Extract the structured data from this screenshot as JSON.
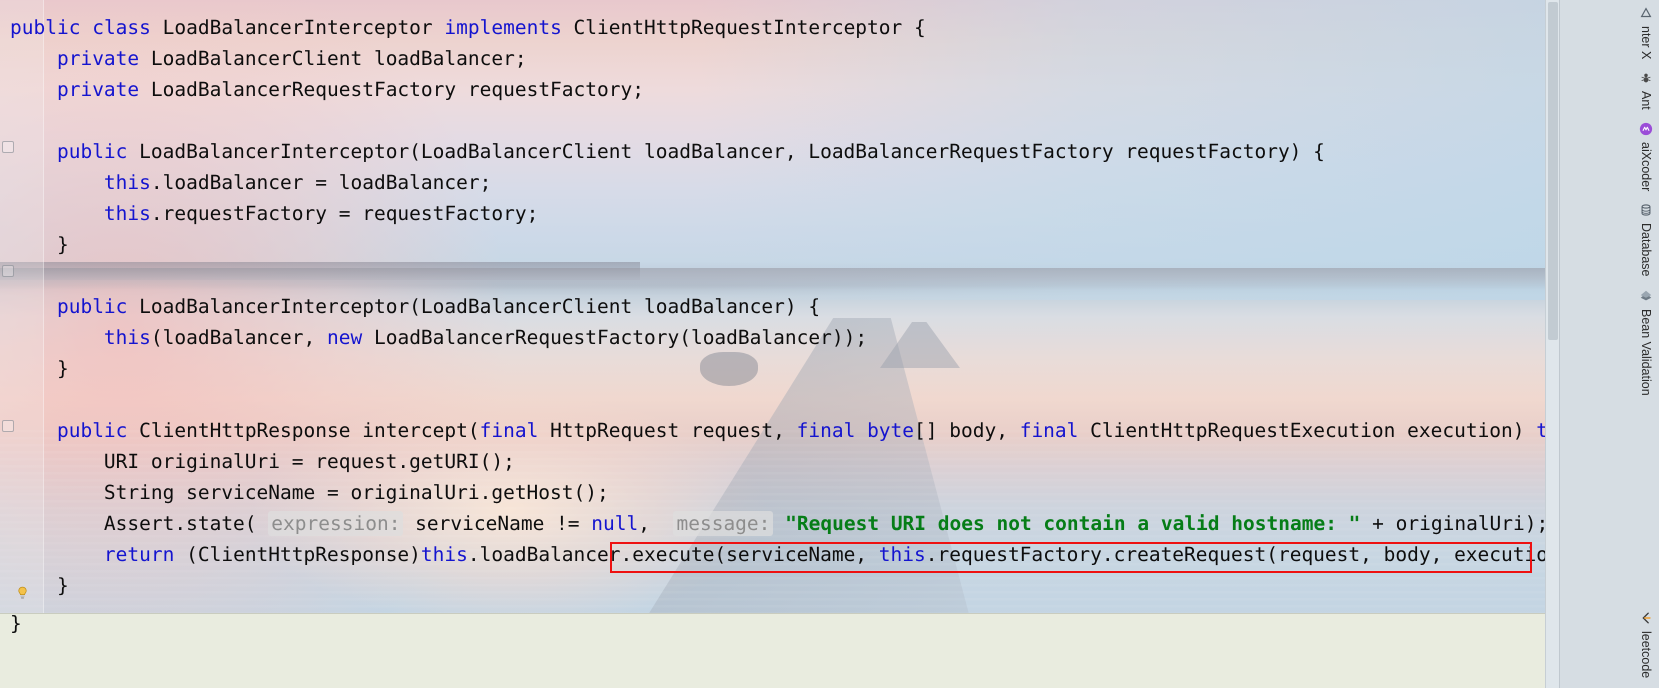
{
  "editor": {
    "language": "java",
    "closing_brace": "}",
    "lines": [
      {
        "indent": 0,
        "tokens": [
          {
            "t": "kw",
            "v": "public"
          },
          {
            "t": "p",
            "v": " "
          },
          {
            "t": "kw",
            "v": "class"
          },
          {
            "t": "p",
            "v": " LoadBalancerInterceptor "
          },
          {
            "t": "kw",
            "v": "implements"
          },
          {
            "t": "p",
            "v": " ClientHttpRequestInterceptor {"
          }
        ]
      },
      {
        "indent": 1,
        "tokens": [
          {
            "t": "kw",
            "v": "private"
          },
          {
            "t": "p",
            "v": " LoadBalancerClient loadBalancer;"
          }
        ]
      },
      {
        "indent": 1,
        "tokens": [
          {
            "t": "kw",
            "v": "private"
          },
          {
            "t": "p",
            "v": " LoadBalancerRequestFactory requestFactory;"
          }
        ]
      },
      {
        "indent": 0,
        "tokens": []
      },
      {
        "indent": 1,
        "tokens": [
          {
            "t": "kw",
            "v": "public"
          },
          {
            "t": "p",
            "v": " LoadBalancerInterceptor(LoadBalancerClient loadBalancer, LoadBalancerRequestFactory requestFactory) {"
          }
        ]
      },
      {
        "indent": 2,
        "tokens": [
          {
            "t": "kw",
            "v": "this"
          },
          {
            "t": "p",
            "v": ".loadBalancer = loadBalancer;"
          }
        ]
      },
      {
        "indent": 2,
        "tokens": [
          {
            "t": "kw",
            "v": "this"
          },
          {
            "t": "p",
            "v": ".requestFactory = requestFactory;"
          }
        ]
      },
      {
        "indent": 1,
        "tokens": [
          {
            "t": "p",
            "v": "}"
          }
        ]
      },
      {
        "indent": 0,
        "tokens": []
      },
      {
        "indent": 1,
        "tokens": [
          {
            "t": "kw",
            "v": "public"
          },
          {
            "t": "p",
            "v": " LoadBalancerInterceptor(LoadBalancerClient loadBalancer) {"
          }
        ]
      },
      {
        "indent": 2,
        "tokens": [
          {
            "t": "kw",
            "v": "this"
          },
          {
            "t": "p",
            "v": "(loadBalancer, "
          },
          {
            "t": "kw",
            "v": "new"
          },
          {
            "t": "p",
            "v": " LoadBalancerRequestFactory(loadBalancer));"
          }
        ]
      },
      {
        "indent": 1,
        "tokens": [
          {
            "t": "p",
            "v": "}"
          }
        ]
      },
      {
        "indent": 0,
        "tokens": []
      },
      {
        "indent": 1,
        "tokens": [
          {
            "t": "kw",
            "v": "public"
          },
          {
            "t": "p",
            "v": " ClientHttpResponse intercept("
          },
          {
            "t": "kw",
            "v": "final"
          },
          {
            "t": "p",
            "v": " HttpRequest request, "
          },
          {
            "t": "kw",
            "v": "final"
          },
          {
            "t": "p",
            "v": " "
          },
          {
            "t": "kw",
            "v": "byte"
          },
          {
            "t": "p",
            "v": "[] body, "
          },
          {
            "t": "kw",
            "v": "final"
          },
          {
            "t": "p",
            "v": " ClientHttpRequestExecution execution) "
          },
          {
            "t": "kw",
            "v": "throws"
          }
        ]
      },
      {
        "indent": 2,
        "tokens": [
          {
            "t": "p",
            "v": "URI originalUri = request.getURI();"
          }
        ]
      },
      {
        "indent": 2,
        "tokens": [
          {
            "t": "p",
            "v": "String serviceName = originalUri.getHost();"
          }
        ]
      },
      {
        "indent": 2,
        "tokens": [
          {
            "t": "p",
            "v": "Assert.state( "
          },
          {
            "t": "hint",
            "v": "expression:"
          },
          {
            "t": "p",
            "v": " serviceName != "
          },
          {
            "t": "kw",
            "v": "null"
          },
          {
            "t": "p",
            "v": ",  "
          },
          {
            "t": "hint",
            "v": "message:"
          },
          {
            "t": "p",
            "v": " "
          },
          {
            "t": "str",
            "v": "\"Request URI does not contain a valid hostname: \""
          },
          {
            "t": "p",
            "v": " + originalUri);"
          }
        ]
      },
      {
        "indent": 2,
        "tokens": [
          {
            "t": "kw",
            "v": "return"
          },
          {
            "t": "p",
            "v": " (ClientHttpResponse)"
          },
          {
            "t": "kw",
            "v": "this"
          },
          {
            "t": "p",
            "v": ".loadBalancer.execute(serviceName, "
          },
          {
            "t": "kw",
            "v": "this"
          },
          {
            "t": "p",
            "v": ".requestFactory.createRequest(request, body, execution));"
          }
        ]
      },
      {
        "indent": 1,
        "tokens": [
          {
            "t": "p",
            "v": "}"
          }
        ]
      }
    ]
  },
  "annotation": {
    "kind": "red-rectangle",
    "color": "#ee1111",
    "surrounds": "execute(serviceName, this.requestFactory.createRequest(request, body, execution));"
  },
  "gutter": {
    "intention_bulb": "lightbulb-icon"
  },
  "tool_windows": {
    "top_items": [
      {
        "label": "nter X",
        "icon": "maven-icon"
      },
      {
        "label": "Ant",
        "icon": "ant-icon"
      },
      {
        "label": "aiXcoder",
        "icon": "aixcoder-icon"
      },
      {
        "label": "Database",
        "icon": "database-icon"
      },
      {
        "label": "Bean Validation",
        "icon": "bean-validation-icon"
      }
    ],
    "bottom_items": [
      {
        "label": "leetcode",
        "icon": "leetcode-icon"
      }
    ]
  },
  "colors": {
    "keyword": "#1414cf",
    "string": "#067d17",
    "parameter_hint": "#8d8d8d",
    "annotation_box": "#ee1111",
    "toolbar_bg": "#d6dde3",
    "bottom_strip_bg": "#e9ecdf"
  }
}
